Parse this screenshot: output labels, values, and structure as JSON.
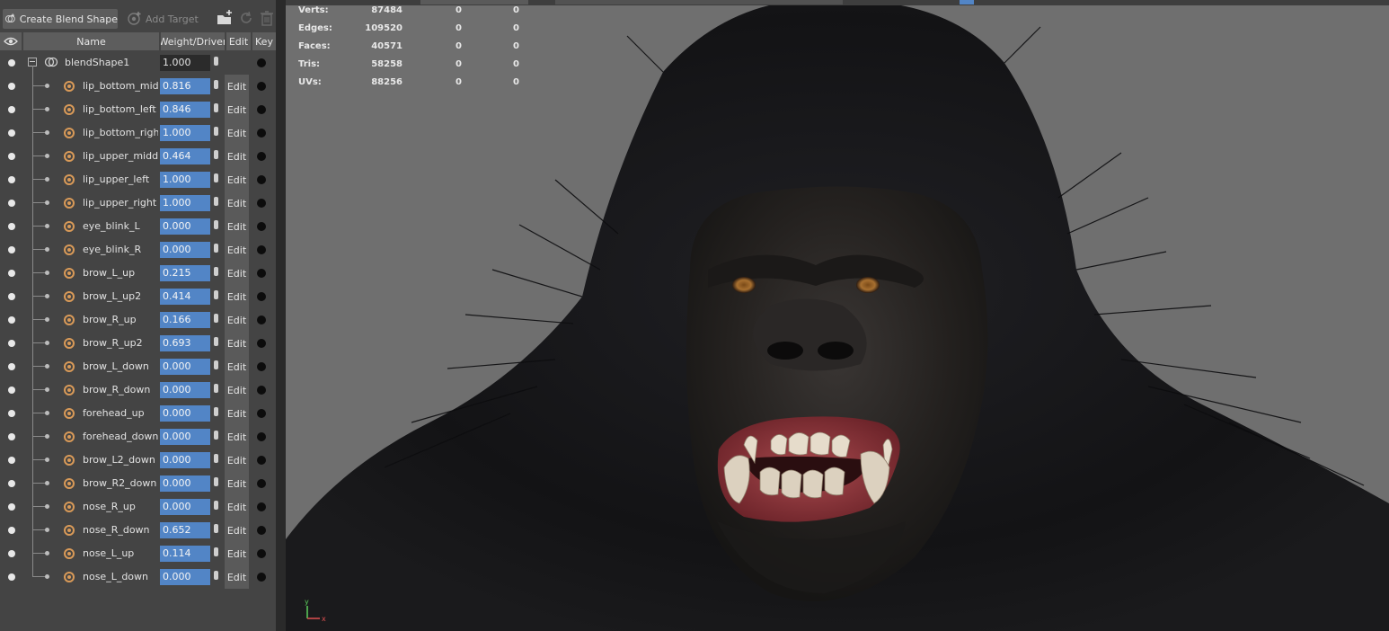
{
  "toolbar": {
    "create_label": "Create Blend Shape",
    "add_label": "Add Target"
  },
  "columns": {
    "name": "Name",
    "weight": "Weight/Driver",
    "edit": "Edit",
    "key": "Key"
  },
  "blendshape": {
    "name": "blendShape1",
    "weight": "1.000"
  },
  "targets": [
    {
      "name": "lip_bottom_middle",
      "weight": "0.816",
      "edit": "Edit"
    },
    {
      "name": "lip_bottom_left",
      "weight": "0.846",
      "edit": "Edit"
    },
    {
      "name": "lip_bottom_right",
      "weight": "1.000",
      "edit": "Edit"
    },
    {
      "name": "lip_upper_middle",
      "weight": "0.464",
      "edit": "Edit"
    },
    {
      "name": "lip_upper_left",
      "weight": "1.000",
      "edit": "Edit"
    },
    {
      "name": "lip_upper_right",
      "weight": "1.000",
      "edit": "Edit"
    },
    {
      "name": "eye_blink_L",
      "weight": "0.000",
      "edit": "Edit"
    },
    {
      "name": "eye_blink_R",
      "weight": "0.000",
      "edit": "Edit"
    },
    {
      "name": "brow_L_up",
      "weight": "0.215",
      "edit": "Edit"
    },
    {
      "name": "brow_L_up2",
      "weight": "0.414",
      "edit": "Edit"
    },
    {
      "name": "brow_R_up",
      "weight": "0.166",
      "edit": "Edit"
    },
    {
      "name": "brow_R_up2",
      "weight": "0.693",
      "edit": "Edit"
    },
    {
      "name": "brow_L_down",
      "weight": "0.000",
      "edit": "Edit"
    },
    {
      "name": "brow_R_down",
      "weight": "0.000",
      "edit": "Edit"
    },
    {
      "name": "forehead_up",
      "weight": "0.000",
      "edit": "Edit"
    },
    {
      "name": "forehead_down",
      "weight": "0.000",
      "edit": "Edit"
    },
    {
      "name": "brow_L2_down",
      "weight": "0.000",
      "edit": "Edit"
    },
    {
      "name": "brow_R2_down",
      "weight": "0.000",
      "edit": "Edit"
    },
    {
      "name": "nose_R_up",
      "weight": "0.000",
      "edit": "Edit"
    },
    {
      "name": "nose_R_down",
      "weight": "0.652",
      "edit": "Edit"
    },
    {
      "name": "nose_L_up",
      "weight": "0.114",
      "edit": "Edit"
    },
    {
      "name": "nose_L_down",
      "weight": "0.000",
      "edit": "Edit"
    }
  ],
  "hud": [
    {
      "label": "Verts:",
      "value": "87484",
      "sel": "0",
      "comp": "0"
    },
    {
      "label": "Edges:",
      "value": "109520",
      "sel": "0",
      "comp": "0"
    },
    {
      "label": "Faces:",
      "value": "40571",
      "sel": "0",
      "comp": "0"
    },
    {
      "label": "Tris:",
      "value": "58258",
      "sel": "0",
      "comp": "0"
    },
    {
      "label": "UVs:",
      "value": "88256",
      "sel": "0",
      "comp": "0"
    }
  ],
  "axis": {
    "y": "y",
    "x": "x"
  },
  "icons": {
    "create": "blend-shape-create-icon",
    "add_target": "add-target-icon",
    "new_group": "new-group-icon",
    "refresh": "refresh-icon",
    "trash": "trash-icon",
    "eye": "eye-icon",
    "target": "target-icon"
  },
  "colors": {
    "panel_bg": "#444444",
    "weight_field": "#5285c6",
    "target_icon": "#d99a58",
    "viewport_bg": "#6f6f6f"
  }
}
